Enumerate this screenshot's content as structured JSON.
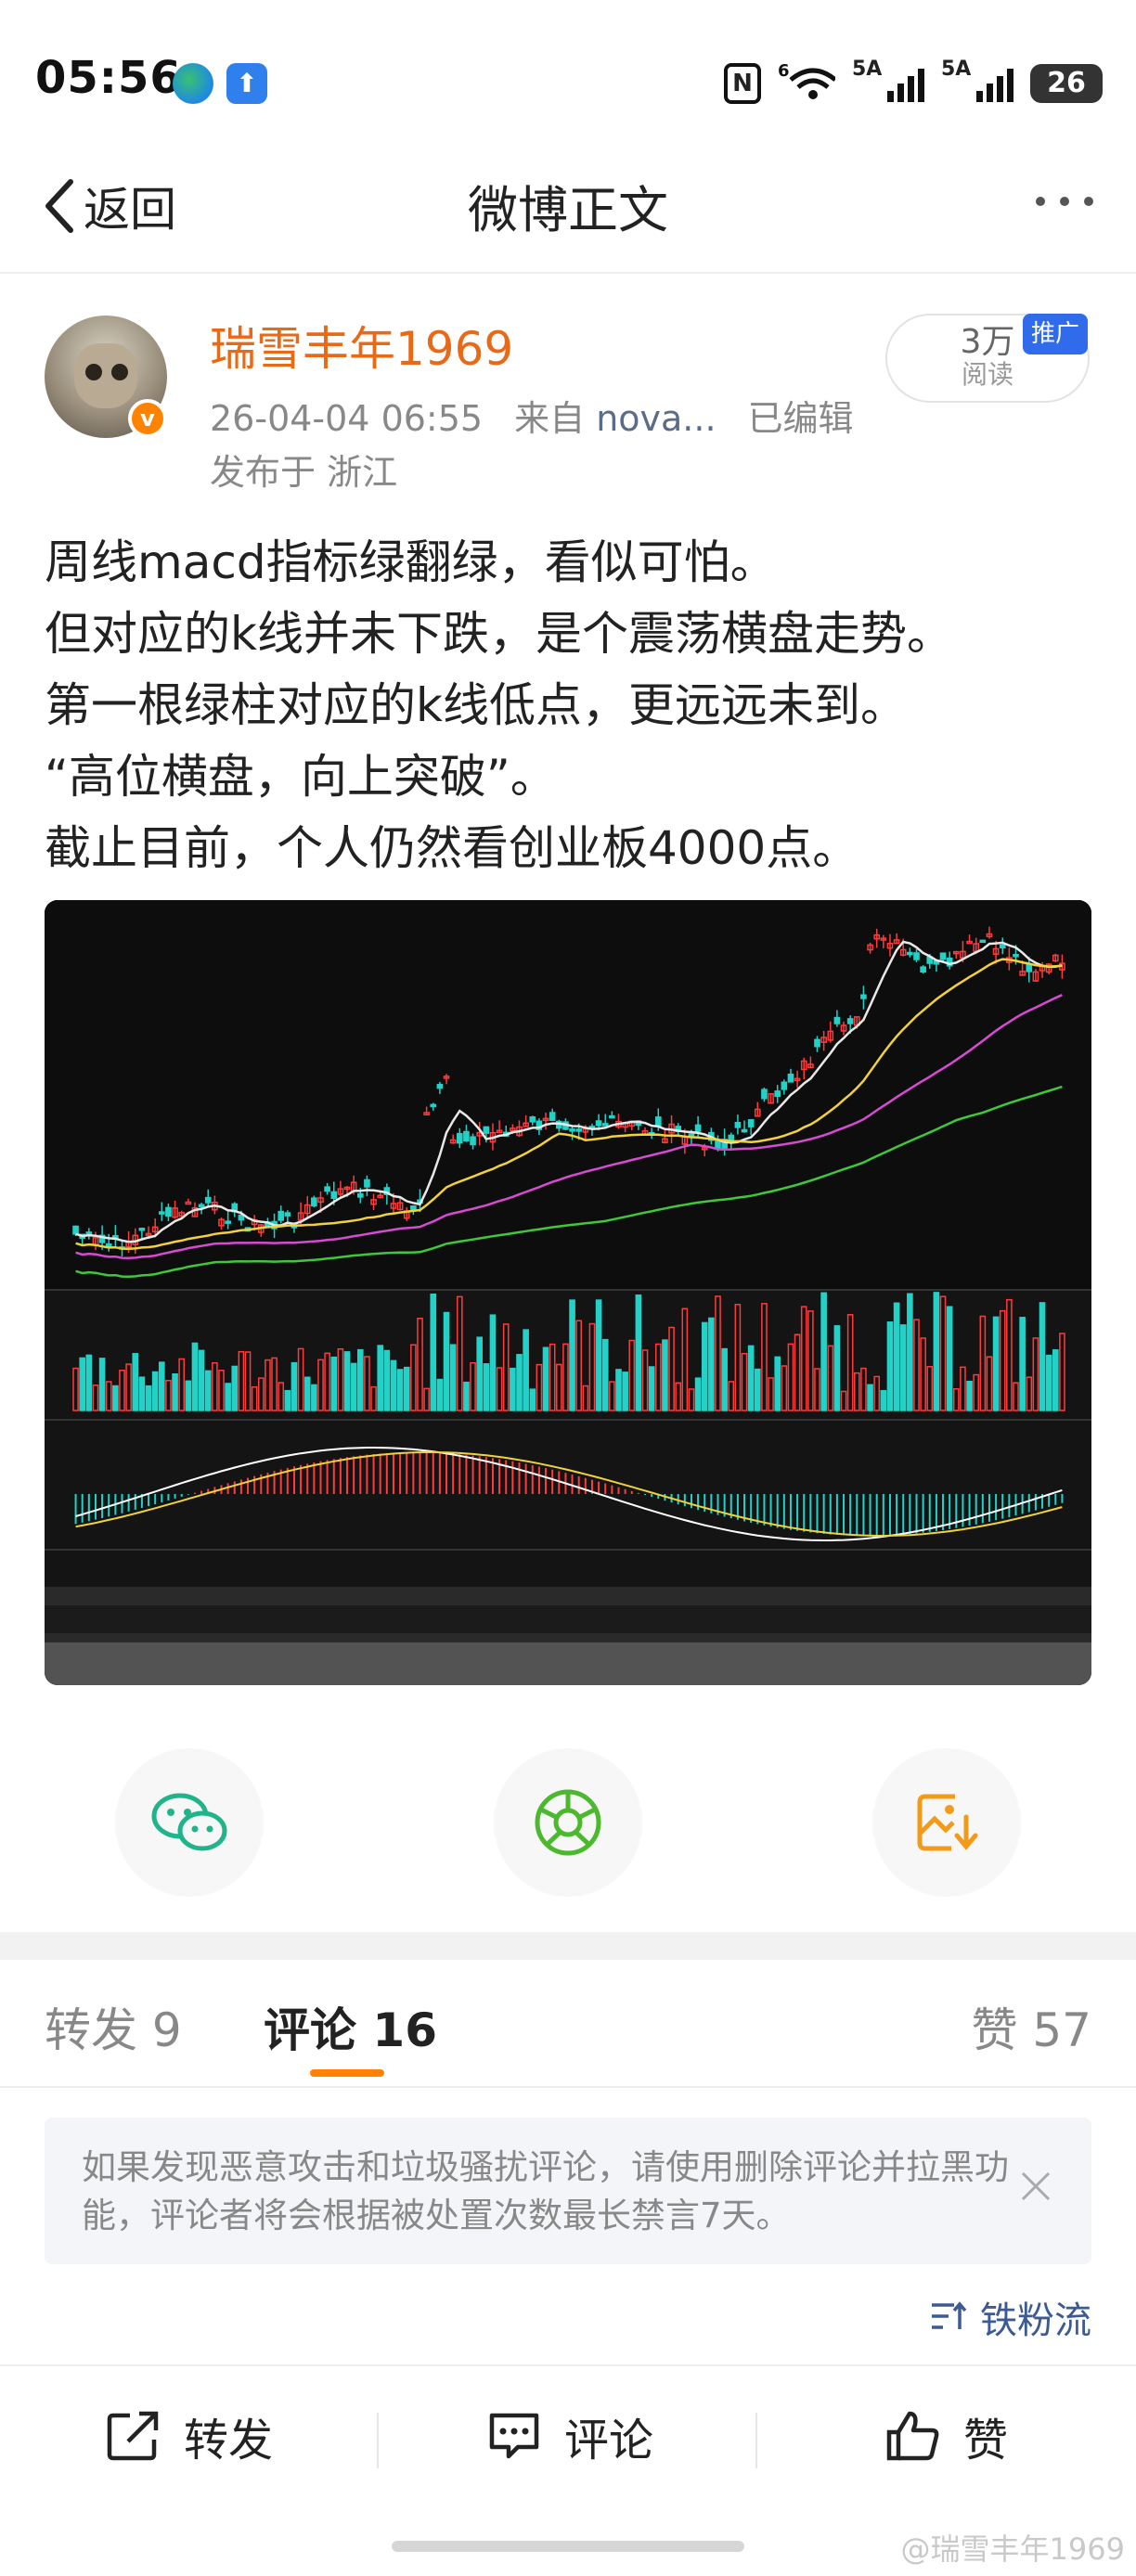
{
  "status_bar": {
    "time": "05:56",
    "signal_1": "5A",
    "signal_2": "5A",
    "wifi": "6",
    "battery": "26"
  },
  "header": {
    "back_label": "返回",
    "title": "微博正文"
  },
  "author": {
    "name": "瑞雪丰年1969",
    "post_time": "26-04-04 06:55",
    "source_prefix": "来自",
    "source": "nova...",
    "edited": "已编辑",
    "location": "发布于 浙江"
  },
  "read_stats": {
    "count": "3万",
    "label": "阅读",
    "promo_tag": "推广"
  },
  "post": {
    "lines": [
      "周线macd指标绿翻绿，看似可怕。",
      "但对应的k线并未下跌，是个震荡横盘走势。",
      "第一根绿柱对应的k线低点，更远远未到。",
      "“高位横盘，向上突破”。",
      "截止目前，个人仍然看创业板4000点。"
    ]
  },
  "share": {
    "icons": [
      "wechat-icon",
      "moments-icon",
      "save-image-icon"
    ]
  },
  "tabs": {
    "repost": "转发 9",
    "comment": "评论 16",
    "like": "赞 57"
  },
  "notice": {
    "text": "如果发现恶意攻击和垃圾骚扰评论，请使用删除评论并拉黑功能，评论者将会根据被处置次数最长禁言7天。"
  },
  "sort": {
    "label": "铁粉流"
  },
  "bottom_bar": {
    "repost": "转发",
    "comment": "评论",
    "like": "赞"
  },
  "watermark": "@瑞雪丰年1969",
  "colors": {
    "accent": "#ff8200",
    "author_name": "#e86a17",
    "link_blue": "#3d5a92",
    "promo_blue": "#2f6bea"
  }
}
